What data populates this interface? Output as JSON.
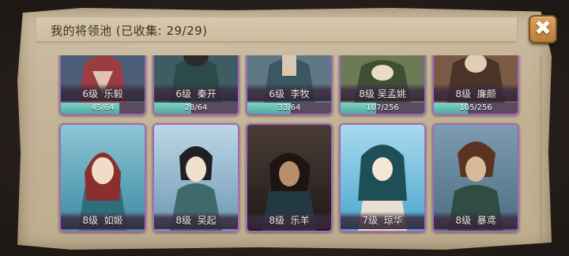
{
  "header": {
    "title": "我的将领池 (已收集: 29/29)"
  },
  "close_button": {
    "icon": "close-icon",
    "glyph": "✖"
  },
  "cards_top": [
    {
      "level_name": "6级  乐毅",
      "progress_text": "45/64",
      "progress": 0.7,
      "bg": [
        "#4b5d77",
        "#a33a3a"
      ]
    },
    {
      "level_name": "6级  秦开",
      "progress_text": "28/64",
      "progress": 0.44,
      "bg": [
        "#3f5c63",
        "#2c4a4a"
      ]
    },
    {
      "level_name": "6级  李牧",
      "progress_text": "33/64",
      "progress": 0.52,
      "bg": [
        "#607786",
        "#3b5762"
      ]
    },
    {
      "level_name": "8级 吴孟姚",
      "progress_text": "107/256",
      "progress": 0.42,
      "bg": [
        "#6d7a56",
        "#3f4f34"
      ]
    },
    {
      "level_name": "8级  廉颇",
      "progress_text": "105/256",
      "progress": 0.41,
      "bg": [
        "#7b5a45",
        "#4b3327"
      ]
    }
  ],
  "cards_bottom": [
    {
      "level_name": "8级  如姬",
      "bg": [
        "#8cc6d6",
        "#3d8aa1"
      ]
    },
    {
      "level_name": "8级  吴起",
      "bg": [
        "#bcd7e6",
        "#6e98b4"
      ]
    },
    {
      "level_name": "8级  乐羊",
      "bg": [
        "#4a3b35",
        "#1f1a18"
      ]
    },
    {
      "level_name": "7级  琼华",
      "bg": [
        "#a9d9ee",
        "#4aa7cf"
      ]
    },
    {
      "level_name": "8级  暴鸢",
      "bg": [
        "#7e9bb0",
        "#4b6d82"
      ]
    }
  ]
}
